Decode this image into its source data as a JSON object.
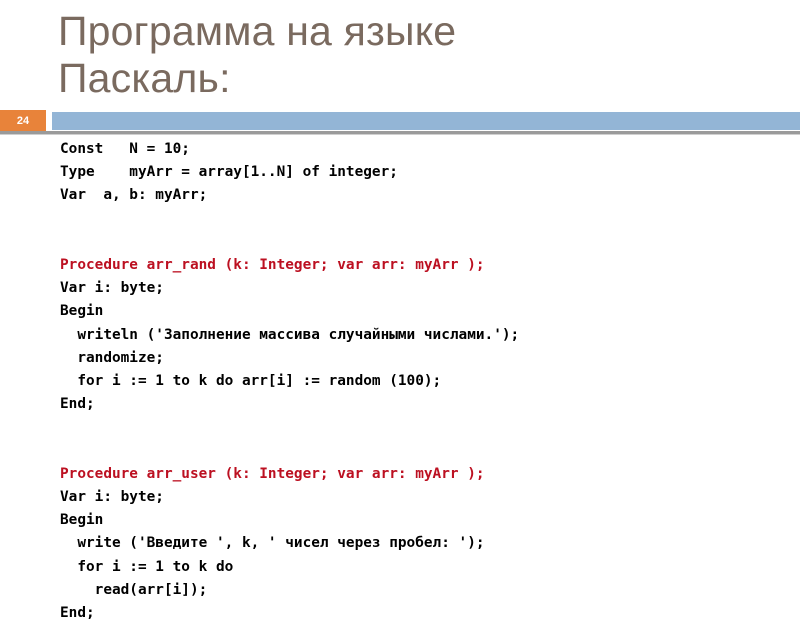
{
  "slide": {
    "title": "Программа на языке\nПаскаль:",
    "page_number": "24",
    "accent_orange": "#e8833a",
    "accent_blue": "#93b5d6",
    "title_color": "#7a6a5f",
    "code_red": "#bc1021",
    "code_black": "#000000"
  },
  "code": {
    "lines": [
      {
        "text": "Const   N = 10;",
        "color": "black",
        "blank": false
      },
      {
        "text": "Type    myArr = array[1..N] of integer;",
        "color": "black",
        "blank": false
      },
      {
        "text": "Var  a, b: myArr;",
        "color": "black",
        "blank": false
      },
      {
        "text": "",
        "color": "black",
        "blank": true
      },
      {
        "text": "",
        "color": "black",
        "blank": true
      },
      {
        "text": "Procedure arr_rand (k: Integer; var arr: myArr );",
        "color": "red",
        "blank": false
      },
      {
        "text": "Var i: byte;",
        "color": "black",
        "blank": false
      },
      {
        "text": "Begin",
        "color": "black",
        "blank": false
      },
      {
        "text": "  writeln ('Заполнение массива случайными числами.');",
        "color": "black",
        "blank": false
      },
      {
        "text": "  randomize;",
        "color": "black",
        "blank": false
      },
      {
        "text": "  for i := 1 to k do arr[i] := random (100);",
        "color": "black",
        "blank": false
      },
      {
        "text": "End;",
        "color": "black",
        "blank": false
      },
      {
        "text": "",
        "color": "black",
        "blank": true
      },
      {
        "text": "",
        "color": "black",
        "blank": true
      },
      {
        "text": "Procedure arr_user (k: Integer; var arr: myArr );",
        "color": "red",
        "blank": false
      },
      {
        "text": "Var i: byte;",
        "color": "black",
        "blank": false
      },
      {
        "text": "Begin",
        "color": "black",
        "blank": false
      },
      {
        "text": "  write ('Введите ', k, ' чисел через пробел: ');",
        "color": "black",
        "blank": false
      },
      {
        "text": "  for i := 1 to k do",
        "color": "black",
        "blank": false
      },
      {
        "text": "    read(arr[i]);",
        "color": "black",
        "blank": false
      },
      {
        "text": "End;",
        "color": "black",
        "blank": false
      }
    ]
  }
}
